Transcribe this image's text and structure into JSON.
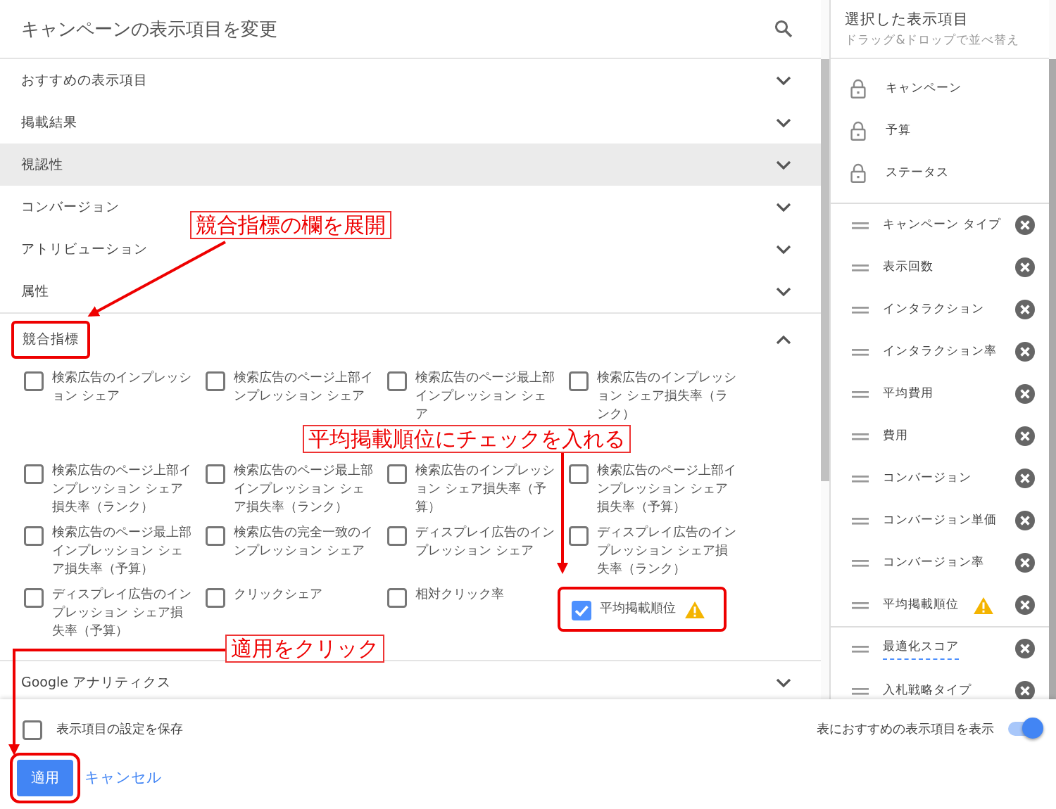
{
  "dialog": {
    "title": "キャンペーンの表示項目を変更"
  },
  "sections": [
    {
      "label": "おすすめの表示項目",
      "expanded": false,
      "highlighted": false
    },
    {
      "label": "掲載結果",
      "expanded": false,
      "highlighted": false
    },
    {
      "label": "視認性",
      "expanded": false,
      "highlighted": true
    },
    {
      "label": "コンバージョン",
      "expanded": false,
      "highlighted": false
    },
    {
      "label": "アトリビューション",
      "expanded": false,
      "highlighted": false
    },
    {
      "label": "属性",
      "expanded": false,
      "highlighted": false
    },
    {
      "label": "競合指標",
      "expanded": true,
      "highlighted": false,
      "options": [
        {
          "label": "検索広告のインプレッション シェア",
          "checked": false,
          "warning": false
        },
        {
          "label": "検索広告のページ上部インプレッション シェア",
          "checked": false,
          "warning": false
        },
        {
          "label": "検索広告のページ最上部インプレッション シェア",
          "checked": false,
          "warning": false
        },
        {
          "label": "検索広告のインプレッション シェア損失率（ランク）",
          "checked": false,
          "warning": false
        },
        {
          "label": "検索広告のページ上部インプレッション シェア損失率（ランク）",
          "checked": false,
          "warning": false
        },
        {
          "label": "検索広告のページ最上部インプレッション シェア損失率（ランク）",
          "checked": false,
          "warning": false
        },
        {
          "label": "検索広告のインプレッション シェア損失率（予算）",
          "checked": false,
          "warning": false
        },
        {
          "label": "検索広告のページ上部インプレッション シェア損失率（予算）",
          "checked": false,
          "warning": false
        },
        {
          "label": "検索広告のページ最上部インプレッション シェア損失率（予算）",
          "checked": false,
          "warning": false
        },
        {
          "label": "検索広告の完全一致のインプレッション シェア",
          "checked": false,
          "warning": false
        },
        {
          "label": "ディスプレイ広告のインプレッション シェア",
          "checked": false,
          "warning": false
        },
        {
          "label": "ディスプレイ広告のインプレッション シェア損失率（ランク）",
          "checked": false,
          "warning": false
        },
        {
          "label": "ディスプレイ広告のインプレッション シェア損失率（予算）",
          "checked": false,
          "warning": false
        },
        {
          "label": "クリックシェア",
          "checked": false,
          "warning": false
        },
        {
          "label": "相対クリック率",
          "checked": false,
          "warning": false
        },
        {
          "label": "平均掲載順位",
          "checked": true,
          "warning": true
        }
      ]
    },
    {
      "label": "Google アナリティクス",
      "expanded": false,
      "highlighted": false
    }
  ],
  "selected_panel": {
    "title": "選択した表示項目",
    "subtitle": "ドラッグ&ドロップで並べ替え",
    "locked": [
      "キャンペーン",
      "予算",
      "ステータス"
    ],
    "columns": [
      {
        "label": "キャンペーン タイプ",
        "warning": false,
        "dotted_underline": false
      },
      {
        "label": "表示回数",
        "warning": false,
        "dotted_underline": false
      },
      {
        "label": "インタラクション",
        "warning": false,
        "dotted_underline": false
      },
      {
        "label": "インタラクション率",
        "warning": false,
        "dotted_underline": false
      },
      {
        "label": "平均費用",
        "warning": false,
        "dotted_underline": false
      },
      {
        "label": "費用",
        "warning": false,
        "dotted_underline": false
      },
      {
        "label": "コンバージョン",
        "warning": false,
        "dotted_underline": false
      },
      {
        "label": "コンバージョン単価",
        "warning": false,
        "dotted_underline": false
      },
      {
        "label": "コンバージョン率",
        "warning": false,
        "dotted_underline": false
      },
      {
        "label": "平均掲載順位",
        "warning": true,
        "dotted_underline": false
      },
      {
        "label": "最適化スコア",
        "warning": false,
        "dotted_underline": true
      },
      {
        "label": "入札戦略タイプ",
        "warning": false,
        "dotted_underline": false
      }
    ]
  },
  "footer": {
    "save_checkbox": {
      "label": "表示項目の設定を保存",
      "checked": false
    },
    "toggle": {
      "label": "表におすすめの表示項目を表示",
      "on": true
    },
    "buttons": [
      {
        "label": "適用",
        "kind": "primary"
      },
      {
        "label": "キャンセル",
        "kind": "text"
      }
    ]
  },
  "annotations": [
    {
      "text": "競合指標の欄を展開"
    },
    {
      "text": "平均掲載順位にチェックを入れる"
    },
    {
      "text": "適用をクリック"
    }
  ]
}
